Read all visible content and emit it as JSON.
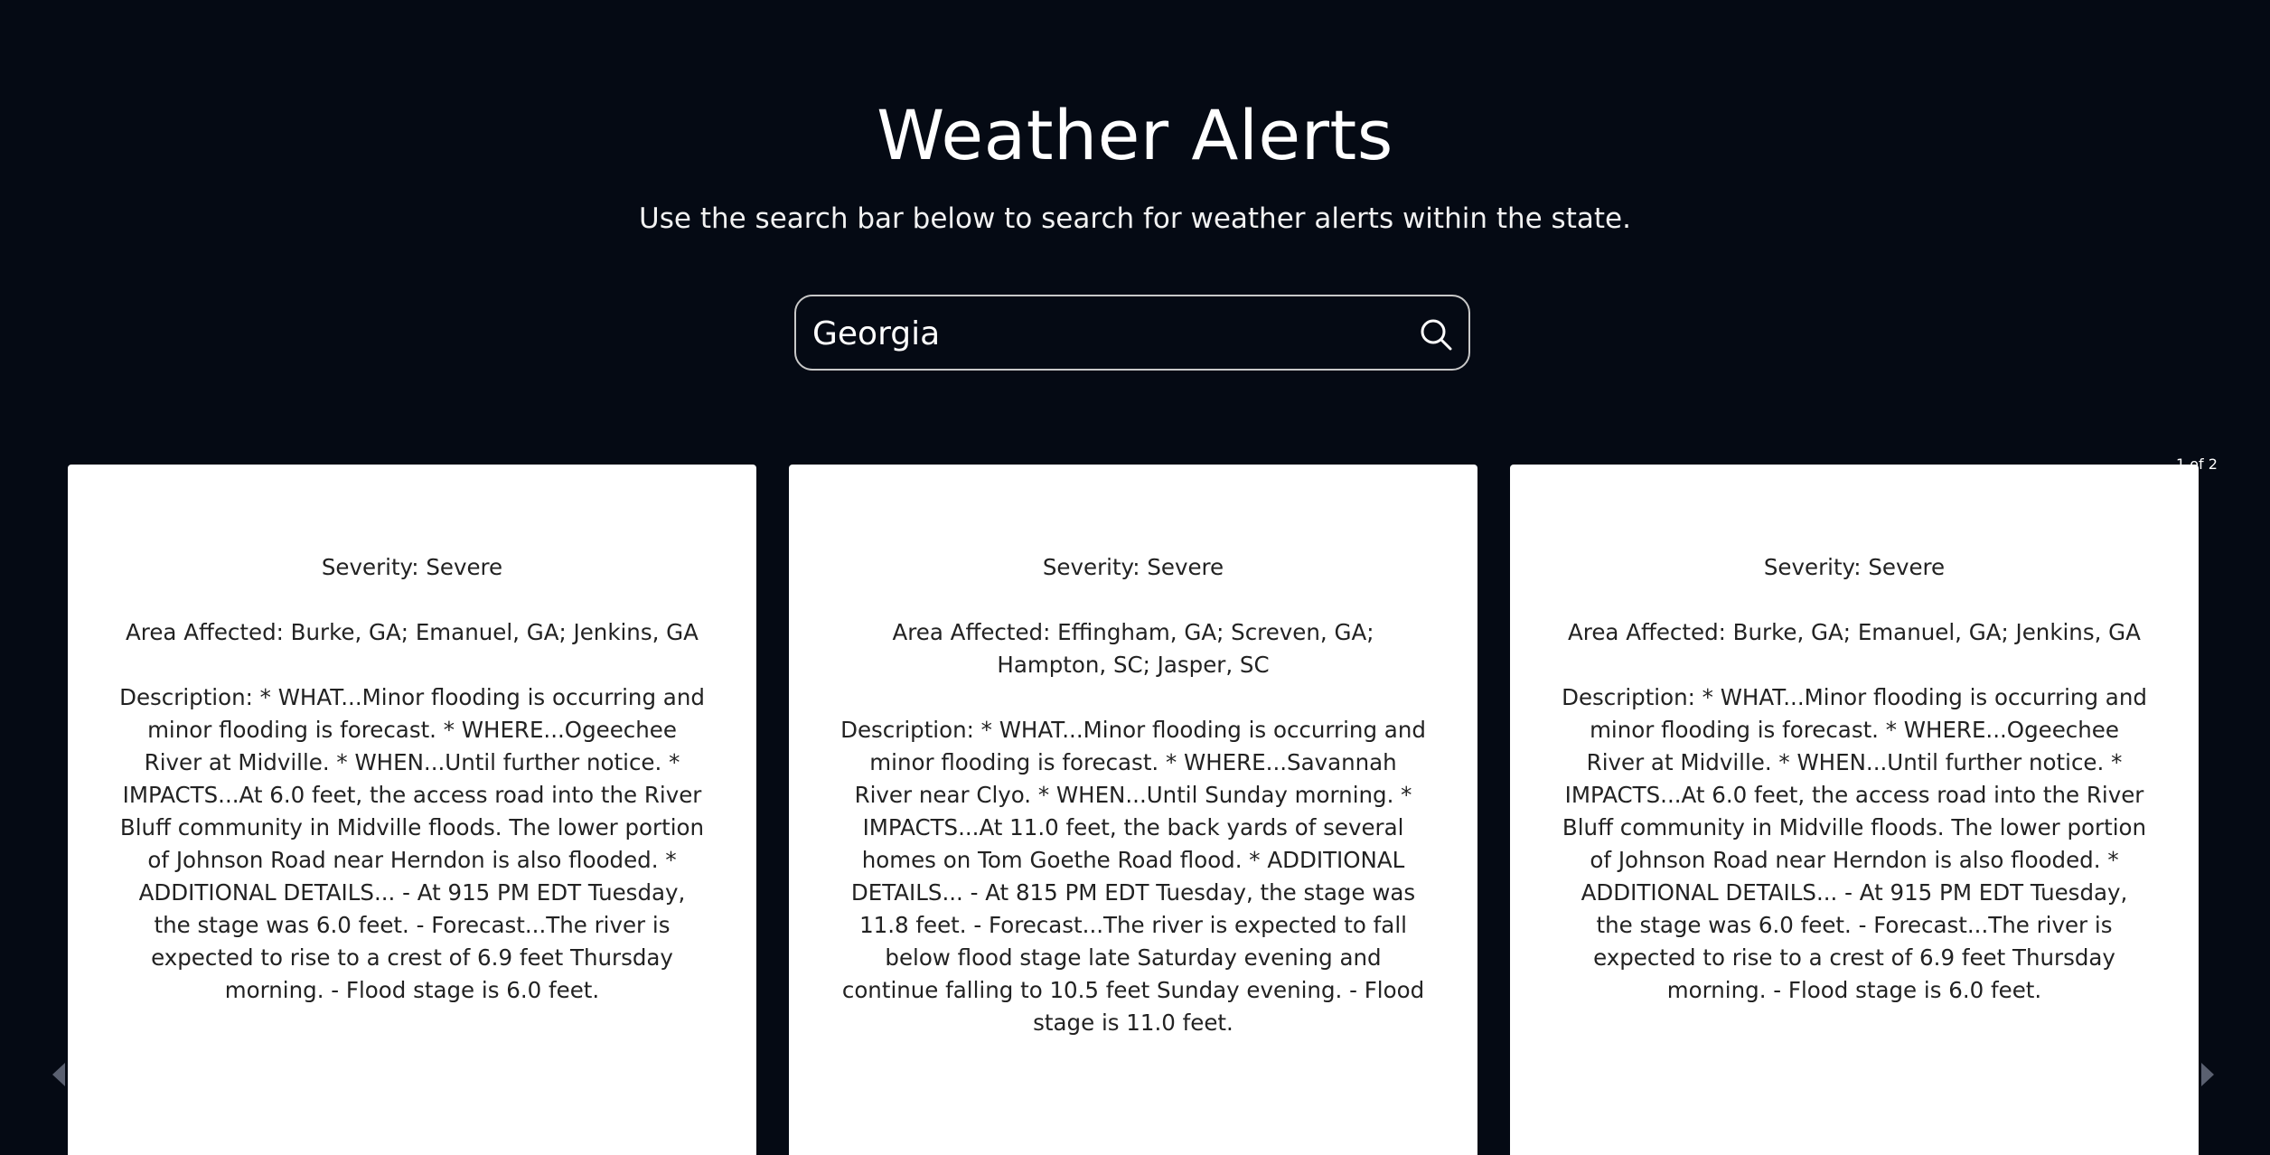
{
  "header": {
    "title": "Weather Alerts",
    "subtitle": "Use the search bar below to search for weather alerts within the state."
  },
  "search": {
    "value": "Georgia",
    "icon": "search-icon"
  },
  "pagination": {
    "label": "1 of 2"
  },
  "alerts": [
    {
      "severity": "Severity: Severe",
      "area": "Area Affected: Burke, GA; Emanuel, GA; Jenkins, GA",
      "description": "Description: * WHAT...Minor flooding is occurring and minor flooding is forecast. * WHERE...Ogeechee River at Midville. * WHEN...Until further notice. * IMPACTS...At 6.0 feet, the access road into the River Bluff community in Midville floods. The lower portion of Johnson Road near Herndon is also flooded. * ADDITIONAL DETAILS... - At 915 PM EDT Tuesday, the stage was 6.0 feet. - Forecast...The river is expected to rise to a crest of 6.9 feet Thursday morning. - Flood stage is 6.0 feet."
    },
    {
      "severity": "Severity: Severe",
      "area": "Area Affected: Effingham, GA; Screven, GA; Hampton, SC; Jasper, SC",
      "description": "Description: * WHAT...Minor flooding is occurring and minor flooding is forecast. * WHERE...Savannah River near Clyo. * WHEN...Until Sunday morning. * IMPACTS...At 11.0 feet, the back yards of several homes on Tom Goethe Road flood. * ADDITIONAL DETAILS... - At 815 PM EDT Tuesday, the stage was 11.8 feet. - Forecast...The river is expected to fall below flood stage late Saturday evening and continue falling to 10.5 feet Sunday evening. - Flood stage is 11.0 feet."
    },
    {
      "severity": "Severity: Severe",
      "area": "Area Affected: Burke, GA; Emanuel, GA; Jenkins, GA",
      "description": "Description: * WHAT...Minor flooding is occurring and minor flooding is forecast. * WHERE...Ogeechee River at Midville. * WHEN...Until further notice. * IMPACTS...At 6.0 feet, the access road into the River Bluff community in Midville floods. The lower portion of Johnson Road near Herndon is also flooded. * ADDITIONAL DETAILS... - At 915 PM EDT Tuesday, the stage was 6.0 feet. - Forecast...The river is expected to rise to a crest of 6.9 feet Thursday morning. - Flood stage is 6.0 feet."
    }
  ],
  "carousel": {
    "prev_icon": "chevron-left-icon",
    "next_icon": "chevron-right-icon"
  }
}
